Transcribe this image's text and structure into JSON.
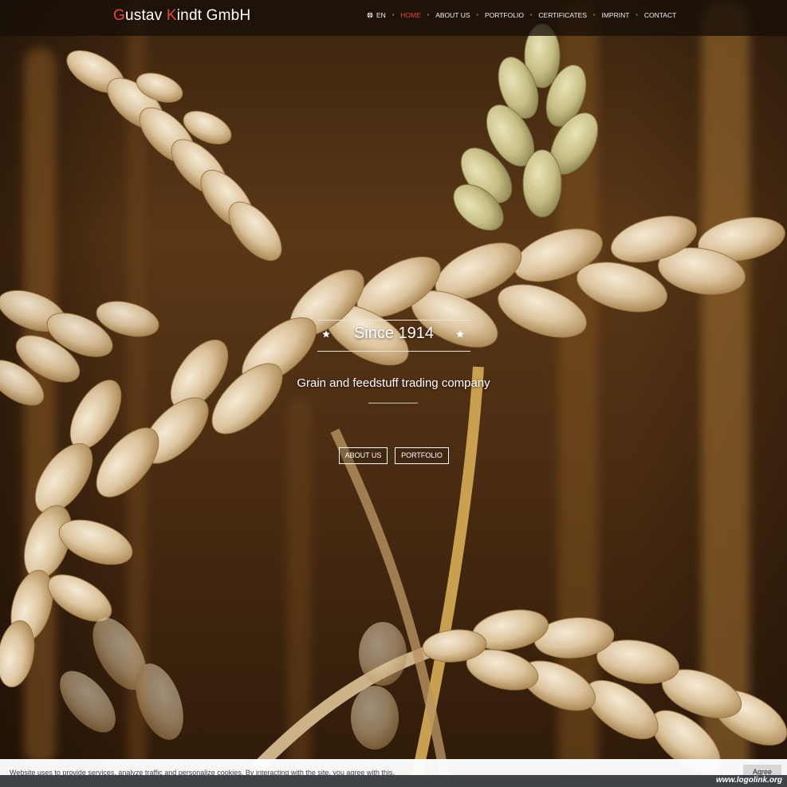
{
  "brand": {
    "first_initial": "G",
    "first_rest": "ustav ",
    "second_initial": "K",
    "second_rest": "indt GmbH"
  },
  "nav": {
    "language": "EN",
    "items": [
      {
        "label": "HOME",
        "active": true
      },
      {
        "label": "ABOUT US"
      },
      {
        "label": "PORTFOLIO"
      },
      {
        "label": "CERTIFICATES"
      },
      {
        "label": "IMPRINT"
      },
      {
        "label": "CONTACT"
      }
    ]
  },
  "hero": {
    "since": "Since 1914",
    "subtitle": "Grain and feedstuff trading company",
    "buttons": [
      {
        "label": "ABOUT US"
      },
      {
        "label": "PORTFOLIO"
      }
    ]
  },
  "cookie": {
    "text": "Website uses to provide services, analyze traffic and personalize cookies. By interacting with the site, you agree with this.",
    "agree_label": "Agree"
  },
  "watermark": "www.logolink.org",
  "colors": {
    "accent": "#e8453c",
    "navbar_bg": "#160e08"
  },
  "icons": {
    "language": "globe-icon",
    "decoration": "star-icon"
  }
}
